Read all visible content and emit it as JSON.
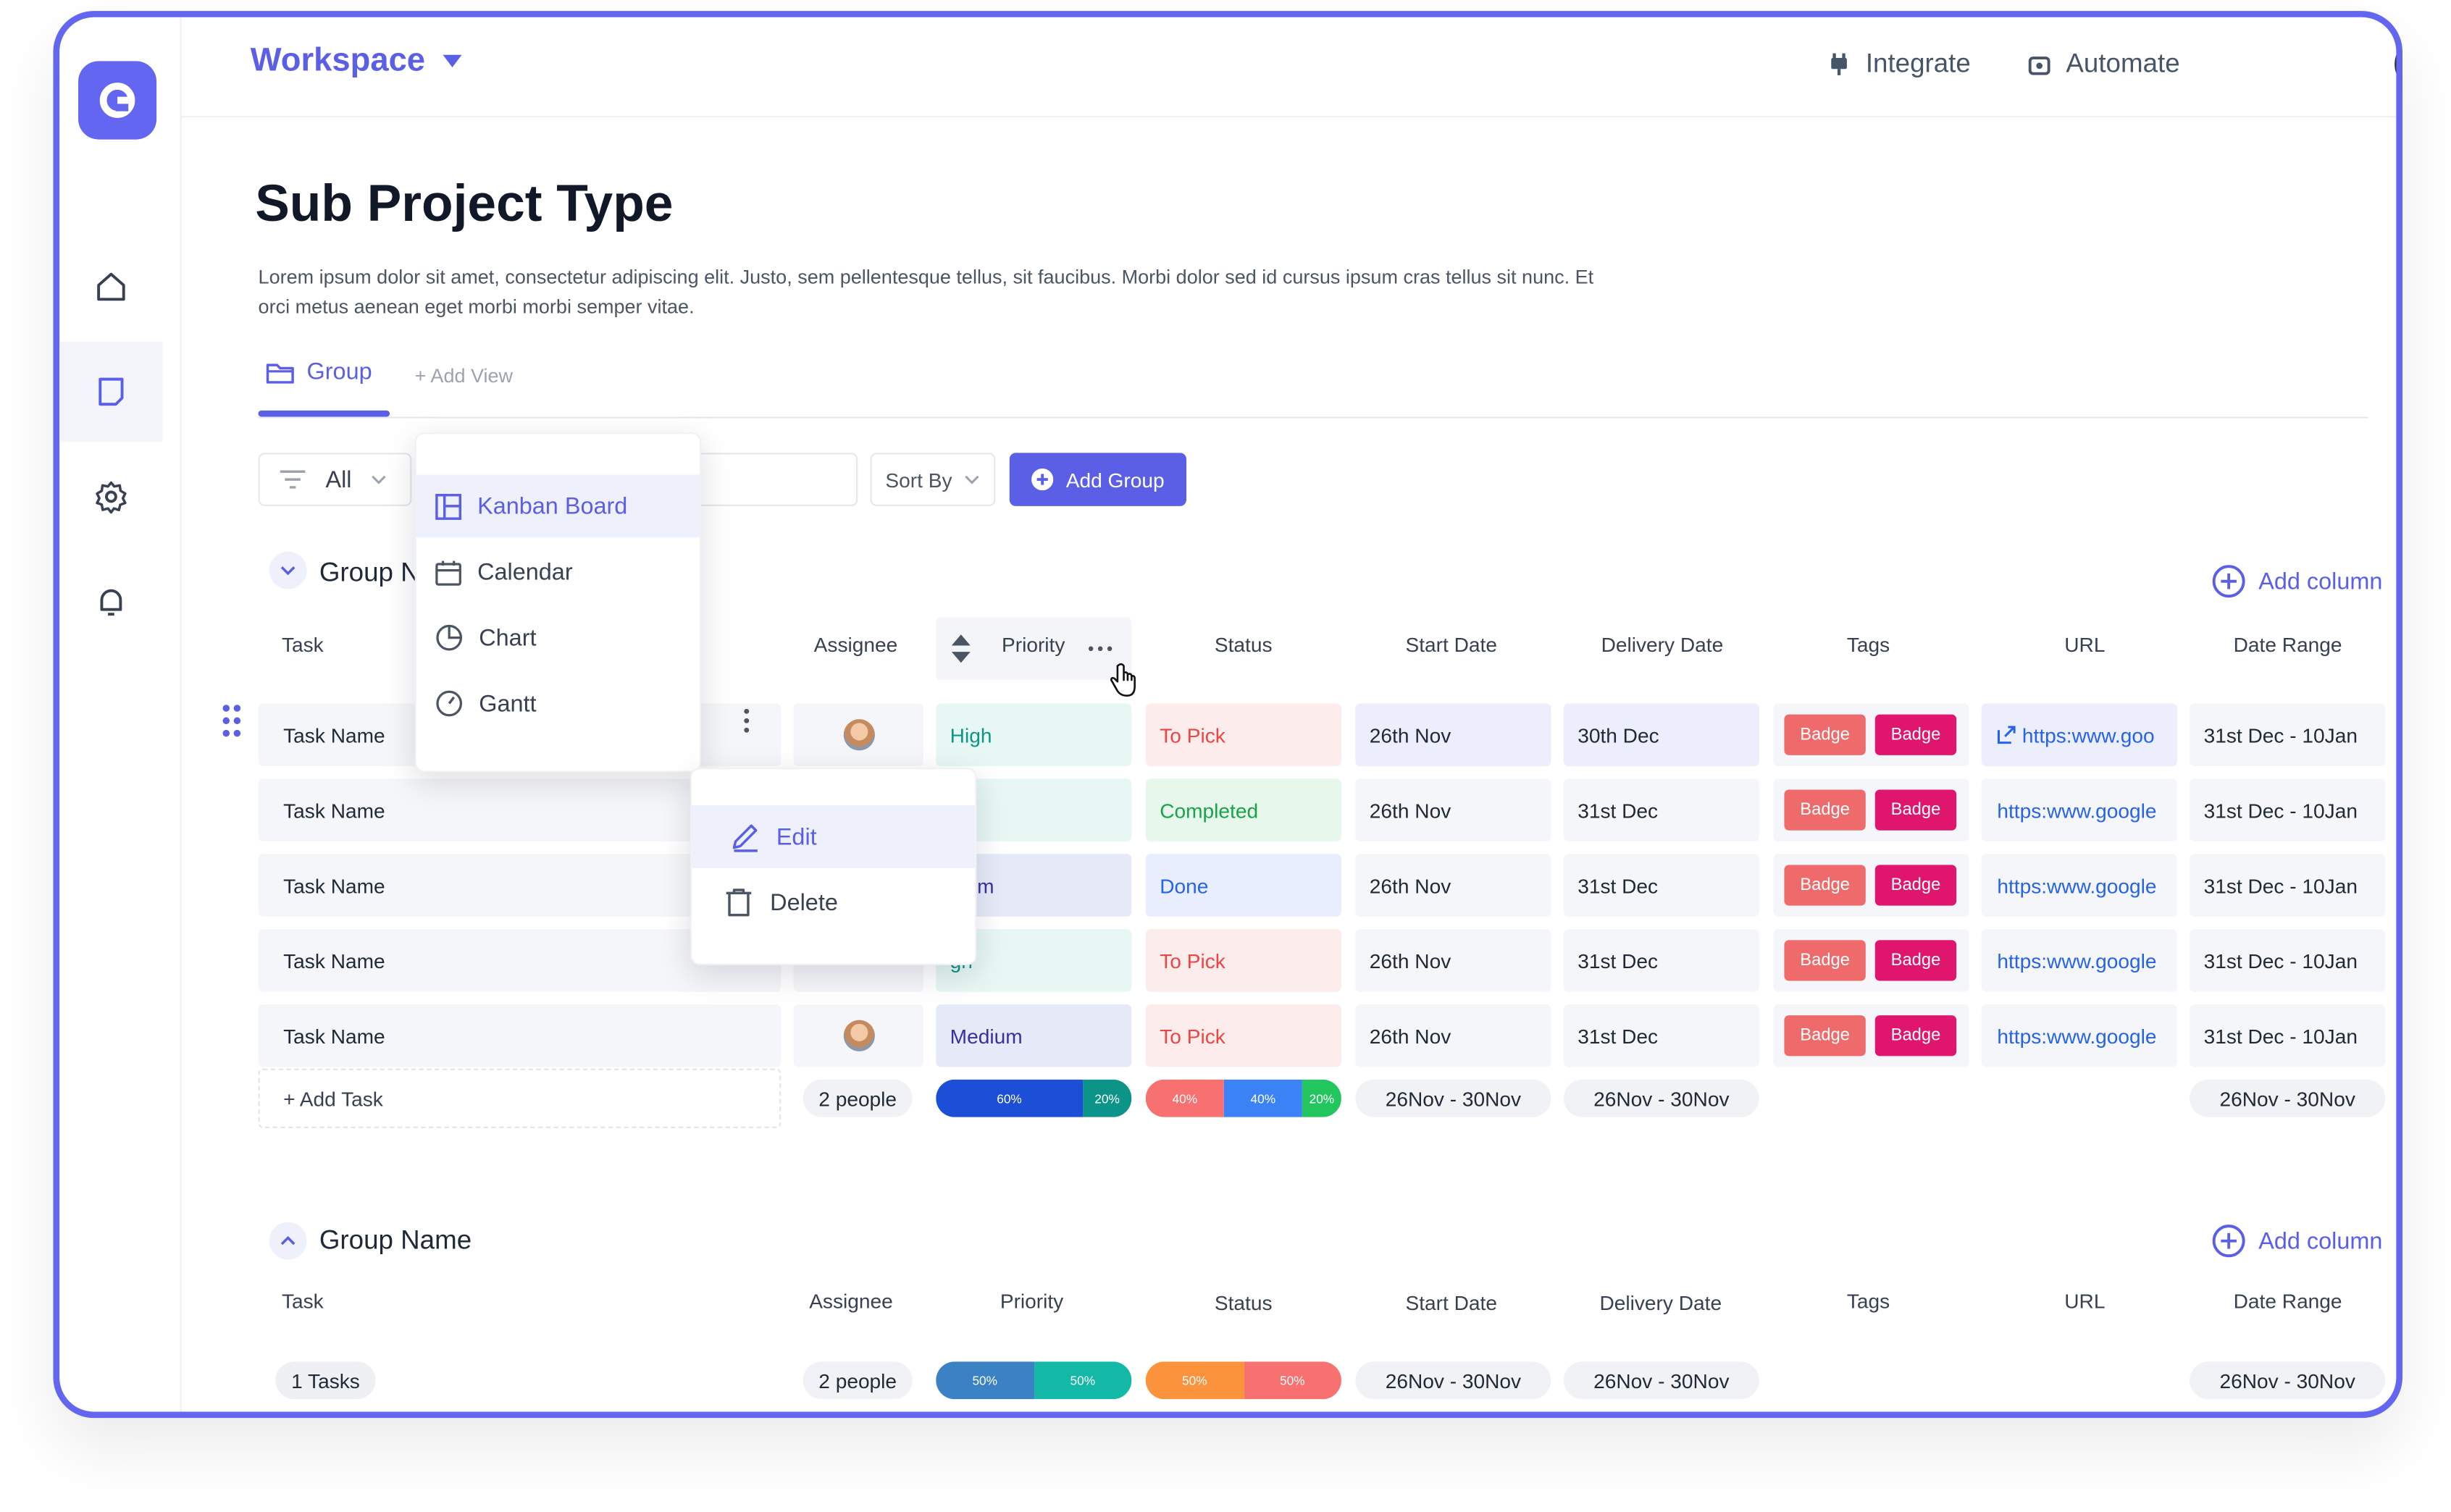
{
  "topbar": {
    "workspace_label": "Workspace",
    "integrate_label": "Integrate",
    "automate_label": "Automate"
  },
  "page": {
    "title": "Sub Project Type",
    "description": "Lorem ipsum dolor sit amet, consectetur adipiscing elit. Justo, sem pellentesque tellus, sit faucibus. Morbi dolor sed id cursus ipsum cras tellus sit nunc. Et orci metus aenean eget morbi morbi semper vitae."
  },
  "tabs": {
    "group_label": "Group",
    "add_view_label": "+ Add View"
  },
  "toolbar": {
    "filter_value": "All",
    "sort_label": "Sort By",
    "add_group_label": "Add Group"
  },
  "view_menu": {
    "items": [
      "Kanban Board",
      "Calendar",
      "Chart",
      "Gantt"
    ],
    "selected": "Kanban Board"
  },
  "row_menu": {
    "edit_label": "Edit",
    "delete_label": "Delete"
  },
  "columns": [
    "Task",
    "Assignee",
    "Priority",
    "Status",
    "Start Date",
    "Delivery Date",
    "Tags",
    "URL",
    "Date Range"
  ],
  "group1": {
    "name": "Group N",
    "add_column_label": "Add column",
    "rows": [
      {
        "task": "Task Name",
        "has_avatar": true,
        "priority": "High",
        "status": "To Pick",
        "start": "26th Nov",
        "delivery": "30th Dec",
        "tags": [
          "Badge",
          "Badge"
        ],
        "url": "https:www.goo",
        "range": "31st Dec - 10Jan"
      },
      {
        "task": "Task Name",
        "has_avatar": false,
        "priority": "gh",
        "status": "Completed",
        "start": "26th Nov",
        "delivery": "31st Dec",
        "tags": [
          "Badge",
          "Badge"
        ],
        "url": "https:www.google",
        "range": "31st Dec - 10Jan"
      },
      {
        "task": "Task Name",
        "has_avatar": false,
        "priority": "dium",
        "status": "Done",
        "start": "26th Nov",
        "delivery": "31st Dec",
        "tags": [
          "Badge",
          "Badge"
        ],
        "url": "https:www.google",
        "range": "31st Dec - 10Jan"
      },
      {
        "task": "Task Name",
        "has_avatar": false,
        "priority": "gh",
        "status": "To Pick",
        "start": "26th Nov",
        "delivery": "31st Dec",
        "tags": [
          "Badge",
          "Badge"
        ],
        "url": "https:www.google",
        "range": "31st Dec - 10Jan"
      },
      {
        "task": "Task Name",
        "has_avatar": true,
        "priority": "Medium",
        "status": "To Pick",
        "start": "26th Nov",
        "delivery": "31st Dec",
        "tags": [
          "Badge",
          "Badge"
        ],
        "url": "https:www.google",
        "range": "31st Dec - 10Jan"
      }
    ],
    "summary": {
      "add_task_label": "+ Add Task",
      "people": "2 people",
      "priority_split": [
        {
          "label": "60%",
          "value": 0.6,
          "color": "#1d4ed8"
        },
        {
          "label": "20%",
          "value": 0.2,
          "color": "#0d9488"
        }
      ],
      "status_split": [
        {
          "label": "40%",
          "value": 0.4,
          "color": "#f87171"
        },
        {
          "label": "40%",
          "value": 0.4,
          "color": "#3b82f6"
        },
        {
          "label": "20%",
          "value": 0.2,
          "color": "#22c55e"
        }
      ],
      "start_range": "26Nov - 30Nov",
      "delivery_range": "26Nov - 30Nov",
      "date_range": "26Nov - 30Nov"
    }
  },
  "group2": {
    "name": "Group Name",
    "add_column_label": "Add column",
    "summary": {
      "tasks": "1 Tasks",
      "people": "2 people",
      "priority_split": [
        {
          "label": "50%",
          "value": 0.5,
          "color": "#3b82c4"
        },
        {
          "label": "50%",
          "value": 0.5,
          "color": "#14b8a6"
        }
      ],
      "status_split": [
        {
          "label": "50%",
          "value": 0.5,
          "color": "#fb923c"
        },
        {
          "label": "50%",
          "value": 0.5,
          "color": "#f87171"
        }
      ],
      "start_range": "26Nov - 30Nov",
      "delivery_range": "26Nov - 30Nov",
      "date_range": "26Nov - 30Nov"
    }
  },
  "colors": {
    "accent": "#5b5fe6",
    "frame": "#6366f1",
    "priority_high_bg": "#e6f7f4",
    "priority_medium_bg": "#e6eaf8",
    "status_topick_bg": "#fdecec",
    "status_completed_bg": "#e7f7ec",
    "status_done_bg": "#e8eefd",
    "badge_light": "#ef6b6b",
    "badge_dark": "#e0156e"
  }
}
